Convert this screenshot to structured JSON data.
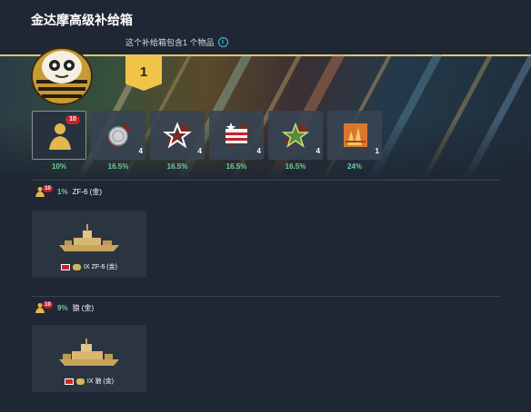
{
  "header": {
    "title": "金达摩高级补给箱",
    "subtitle": "这个补给箱包含1 个物品",
    "info_icon": "info-icon"
  },
  "banner": {
    "count": "1",
    "accent": "#f1c349"
  },
  "items": [
    {
      "name": "captain",
      "icon": "captain-silhouette-icon",
      "badge": "10",
      "qty": "",
      "chance": "10%"
    },
    {
      "name": "coins",
      "icon": "coins-icon",
      "badge": "",
      "qty": "4",
      "chance": "16.5%"
    },
    {
      "name": "star-red",
      "icon": "star-icon",
      "badge": "",
      "qty": "4",
      "chance": "16.5%"
    },
    {
      "name": "flag-stripes",
      "icon": "flag-icon",
      "badge": "",
      "qty": "4",
      "chance": "16.5%"
    },
    {
      "name": "star-green",
      "icon": "star-green-icon",
      "badge": "",
      "qty": "4",
      "chance": "16.5%"
    },
    {
      "name": "camouflage",
      "icon": "camouflage-icon",
      "badge": "",
      "qty": "1",
      "chance": "24%"
    }
  ],
  "groups": [
    {
      "badge": "10",
      "chance": "1%",
      "name": "ZF-6 (金)",
      "ship_label": "IX ZF-6 (金)",
      "nation_color": "#c4222c"
    },
    {
      "badge": "10",
      "chance": "9%",
      "name": "狼 (金)",
      "ship_label": "IX 狼 (金)",
      "nation_color": "#d3232a"
    }
  ]
}
